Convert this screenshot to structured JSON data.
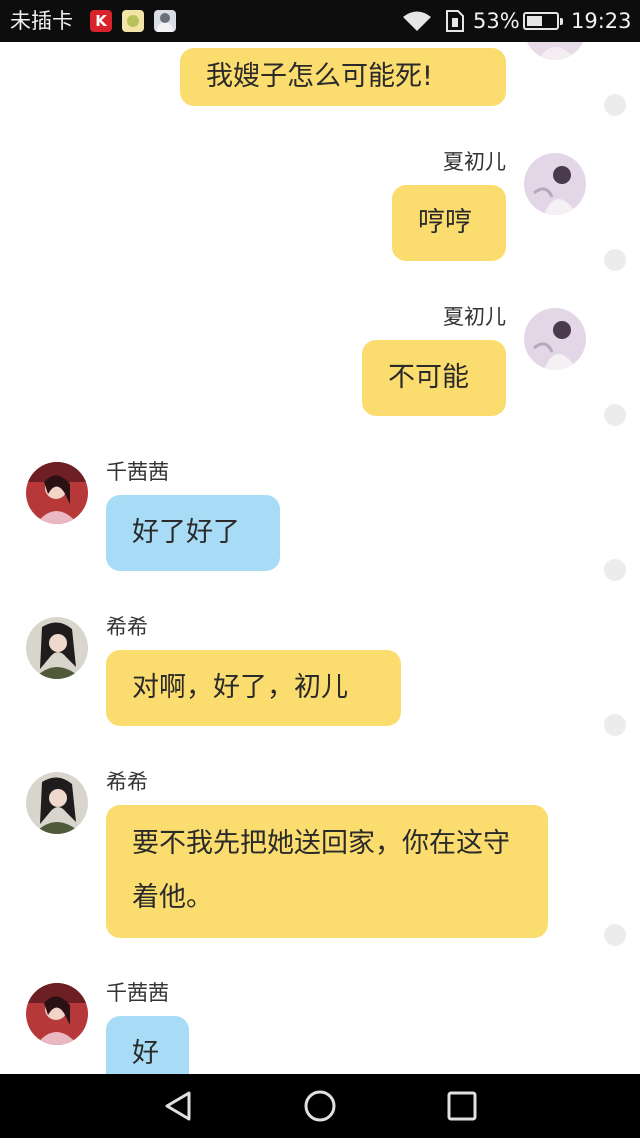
{
  "status_bar": {
    "carrier": "未插卡",
    "app_icons": [
      "k-app-icon",
      "chat-app-icon",
      "photo-app-icon"
    ],
    "battery_percent": "53%",
    "battery_level": 0.53,
    "time": "19:23"
  },
  "colors": {
    "yellow_bubble": "#fbdc6e",
    "blue_bubble": "#a8dcf6",
    "status_bar_bg": "#0d0d0d",
    "nav_bar_bg": "#000000"
  },
  "messages": [
    {
      "sender": "",
      "side": "right",
      "text": "我嫂子怎么可能死!",
      "color": "yellow"
    },
    {
      "sender": "夏初儿",
      "side": "right",
      "text": "哼哼",
      "color": "yellow"
    },
    {
      "sender": "夏初儿",
      "side": "right",
      "text": "不可能",
      "color": "yellow"
    },
    {
      "sender": "千茜茜",
      "side": "left",
      "text": "好了好了",
      "color": "blue"
    },
    {
      "sender": "希希",
      "side": "left",
      "text": "对啊，好了，初儿",
      "color": "yellow"
    },
    {
      "sender": "希希",
      "side": "left",
      "text": "要不我先把她送回家，你在这守着他。",
      "color": "yellow"
    },
    {
      "sender": "千茜茜",
      "side": "left",
      "text": "好",
      "color": "blue"
    }
  ],
  "nav_bar": {
    "buttons": [
      "back-icon",
      "home-icon",
      "recents-icon"
    ]
  }
}
